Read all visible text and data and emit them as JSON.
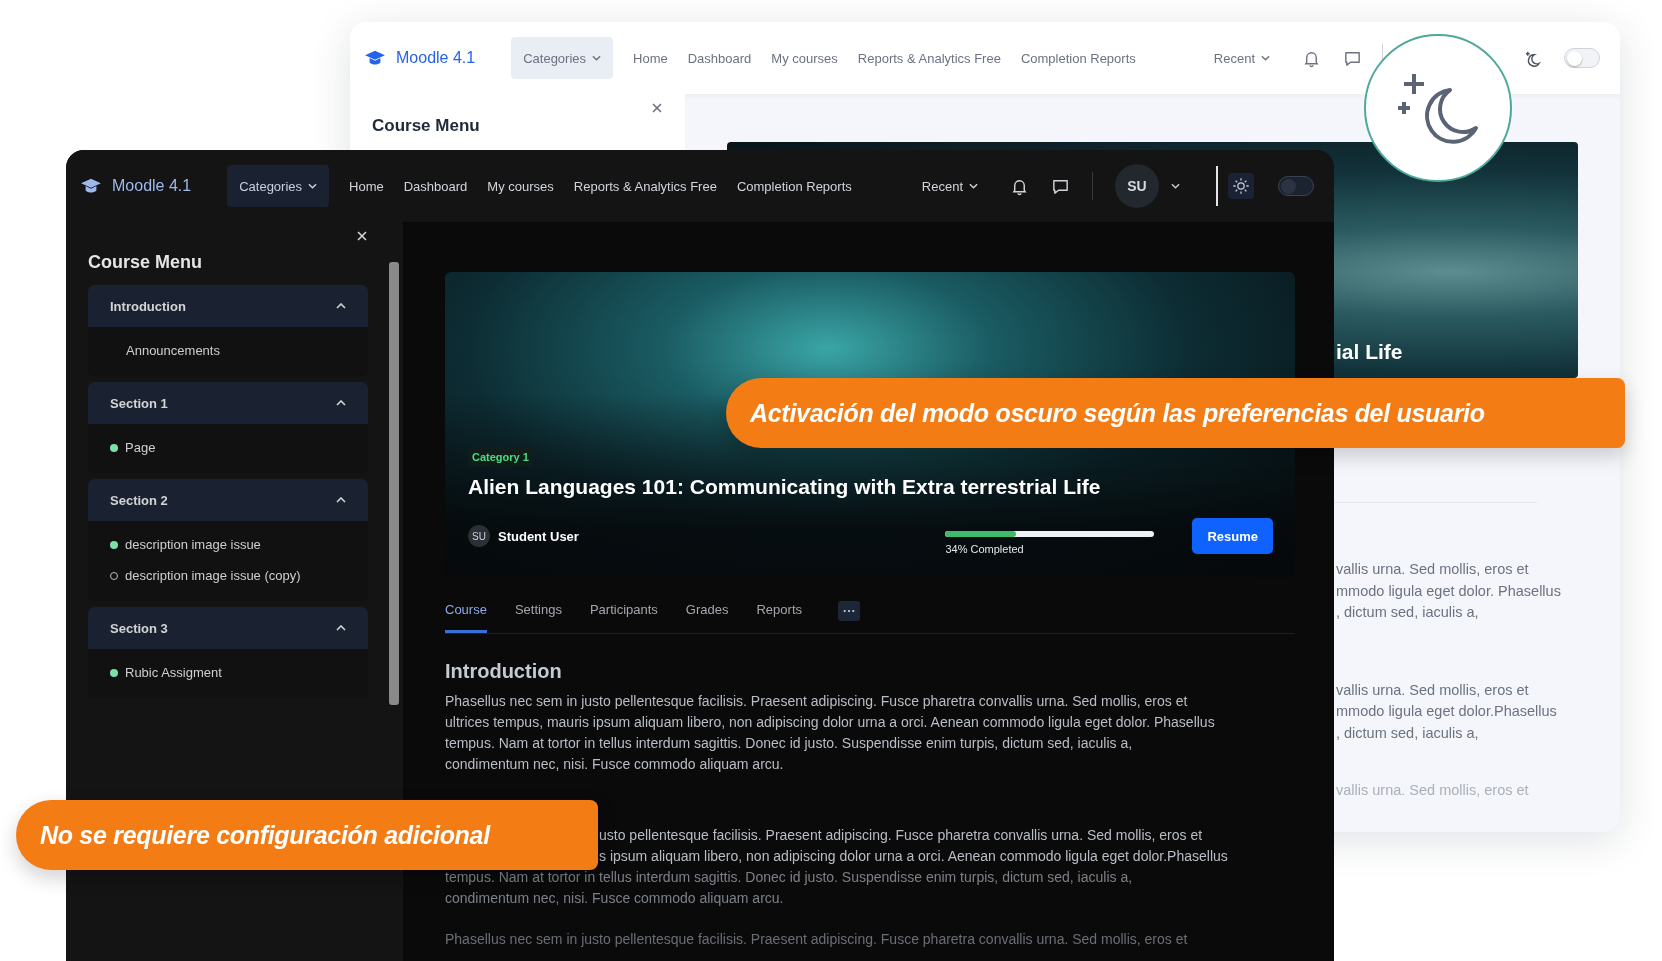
{
  "light_window": {
    "brand": "Moodle 4.1",
    "categories": "Categories",
    "nav": [
      "Home",
      "Dashboard",
      "My courses",
      "Reports & Analytics Free",
      "Completion Reports"
    ],
    "recent": "Recent",
    "dark_mode_toggle": {
      "on": false
    },
    "sidebar_title": "Course Menu",
    "hero_title_fragment": "ial Life",
    "text_groups": [
      {
        "faded": false,
        "lines": [
          "vallis urna. Sed mollis, eros et",
          "mmodo ligula eget dolor. Phasellus",
          ", dictum sed, iaculis a,"
        ]
      },
      {
        "faded": false,
        "lines": [
          "vallis urna. Sed mollis, eros et",
          "mmodo ligula eget dolor.Phasellus",
          ", dictum sed, iaculis a,"
        ]
      },
      {
        "faded": true,
        "lines": [
          "vallis urna. Sed mollis, eros et"
        ]
      }
    ]
  },
  "dark_window": {
    "brand": "Moodle 4.1",
    "categories": "Categories",
    "nav": [
      "Home",
      "Dashboard",
      "My courses",
      "Reports & Analytics Free",
      "Completion Reports"
    ],
    "recent": "Recent",
    "user_initials": "SU",
    "dark_mode_toggle": {
      "on": false
    },
    "sidebar": {
      "title": "Course Menu",
      "sections": [
        {
          "title": "Introduction",
          "expanded": true,
          "items": [
            {
              "label": "Announcements",
              "kind": "plain"
            }
          ]
        },
        {
          "title": "Section 1",
          "expanded": true,
          "items": [
            {
              "label": "Page",
              "kind": "complete"
            }
          ]
        },
        {
          "title": "Section 2",
          "expanded": true,
          "items": [
            {
              "label": "description image issue",
              "kind": "complete"
            },
            {
              "label": "description image issue (copy)",
              "kind": "incomplete"
            }
          ]
        },
        {
          "title": "Section 3",
          "expanded": true,
          "items": [
            {
              "label": "Rubic Assigment",
              "kind": "complete"
            }
          ]
        }
      ]
    },
    "course": {
      "category": "Category 1",
      "title": "Alien Languages 101: Communicating with Extra terrestrial Life",
      "user": {
        "initials": "SU",
        "name": "Student User"
      },
      "progress": {
        "level": 0.34,
        "label": "34% Completed"
      },
      "resume": "Resume"
    },
    "tabs": [
      {
        "label": "Course",
        "selected": true
      },
      {
        "label": "Settings",
        "selected": false
      },
      {
        "label": "Participants",
        "selected": false
      },
      {
        "label": "Grades",
        "selected": false
      },
      {
        "label": "Reports",
        "selected": false
      }
    ],
    "content": {
      "heading": "Introduction",
      "paragraphs": [
        {
          "faded": false,
          "lines": [
            "Phasellus nec sem in justo pellentesque facilisis. Praesent adipiscing. Fusce pharetra convallis urna. Sed mollis, eros et",
            "ultrices tempus, mauris ipsum aliquam libero, non adipiscing dolor urna a orci. Aenean commodo ligula eget dolor. Phasellus",
            "tempus. Nam at tortor in tellus interdum sagittis. Donec id justo. Suspendisse enim turpis, dictum sed, iaculis a,",
            "condimentum nec, nisi. Fusce commodo aliquam arcu."
          ]
        },
        {
          "faded": false,
          "lines": [
            "usto pellentesque facilisis. Praesent adipiscing. Fusce pharetra convallis urna. Sed mollis, eros et",
            "s ipsum aliquam libero, non adipiscing dolor urna a orci. Aenean commodo ligula eget dolor.Phasellus",
            "tempus. Nam at tortor in tellus interdum sagittis. Donec id justo. Suspendisse enim turpis, dictum sed, iaculis a,",
            "condimentum nec, nisi. Fusce commodo aliquam arcu."
          ]
        },
        {
          "faded": true,
          "lines": [
            "Phasellus nec sem in justo pellentesque facilisis. Praesent adipiscing. Fusce pharetra convallis urna. Sed mollis, eros et"
          ]
        }
      ]
    }
  },
  "callouts": [
    "Activación del modo oscuro según las preferencias del usuario",
    "No se requiere configuración adicional"
  ]
}
